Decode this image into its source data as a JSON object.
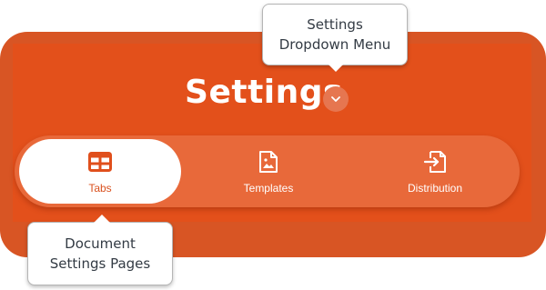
{
  "header": {
    "title": "Settings"
  },
  "tabs": [
    {
      "label": "Tabs",
      "icon": "table-icon",
      "active": true
    },
    {
      "label": "Templates",
      "icon": "document-image-icon",
      "active": false
    },
    {
      "label": "Distribution",
      "icon": "export-document-icon",
      "active": false
    }
  ],
  "callouts": {
    "dropdown": [
      "Settings",
      "Dropdown Menu"
    ],
    "pages": [
      "Document",
      "Settings Pages"
    ]
  },
  "colors": {
    "brand": "#e3501b",
    "frame": "#d85524",
    "tab_bar": "#e8693a",
    "active_text": "#d9511f"
  }
}
